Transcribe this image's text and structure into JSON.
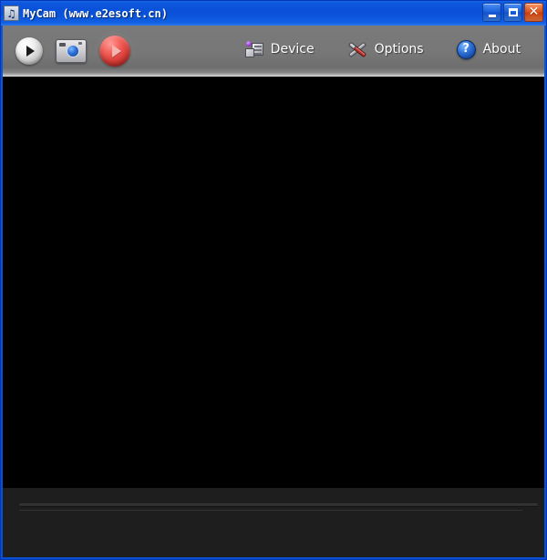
{
  "window": {
    "title": "MyCam (www.e2esoft.cn)",
    "app_icon": "music-note-icon",
    "accent_color": "#0a50d8",
    "border_color": "#0437b4"
  },
  "title_buttons": [
    {
      "name": "minimize-button",
      "glyph": "_",
      "label": "Minimize",
      "color": "#1c62df"
    },
    {
      "name": "maximize-button",
      "glyph": "□",
      "label": "Maximize",
      "color": "#1c62df"
    },
    {
      "name": "close-button",
      "glyph": "✕",
      "label": "Close",
      "color": "#e25a20"
    }
  ],
  "toolbar": {
    "background_color": "#777777",
    "left_buttons": [
      {
        "name": "preview-button",
        "icon": "play-circle-icon",
        "label": ""
      },
      {
        "name": "snapshot-button",
        "icon": "camera-icon",
        "label": ""
      },
      {
        "name": "record-button",
        "icon": "record-circle-icon",
        "label": "",
        "color": "#d43a34"
      }
    ],
    "menu_items": [
      {
        "name": "device-menu",
        "icon": "webcam-device-icon",
        "label": "Device"
      },
      {
        "name": "options-menu",
        "icon": "tools-icon",
        "label": "Options"
      },
      {
        "name": "about-menu",
        "icon": "question-circle-icon",
        "label": "About"
      }
    ]
  },
  "video": {
    "background_color": "#000000",
    "content": ""
  },
  "bottom_panel": {
    "background_color": "#1e1e1e",
    "divider": "groove-separator"
  }
}
